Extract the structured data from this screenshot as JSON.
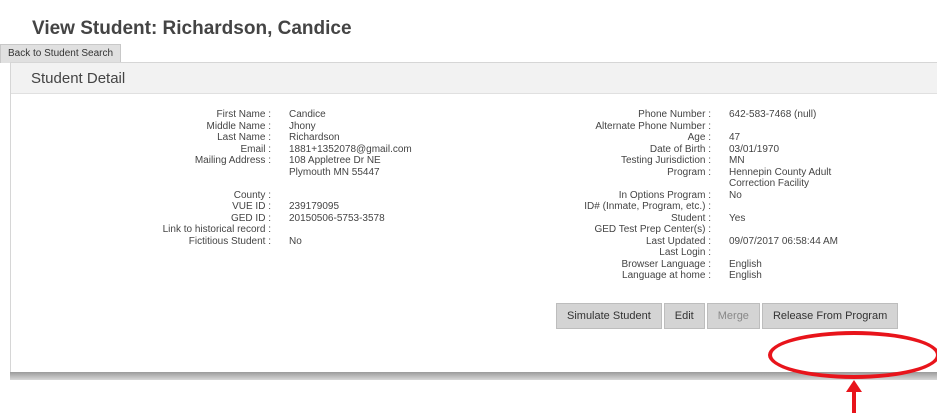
{
  "page": {
    "title": "View Student: Richardson, Candice"
  },
  "nav": {
    "back_label": "Back to Student Search"
  },
  "panel": {
    "title": "Student Detail"
  },
  "left_fields": [
    {
      "label": "First Name :",
      "value": "Candice"
    },
    {
      "label": "Middle Name :",
      "value": "Jhony"
    },
    {
      "label": "Last Name :",
      "value": "Richardson"
    },
    {
      "label": "Email :",
      "value": "1881+1352078@gmail.com"
    },
    {
      "label": "Mailing Address :",
      "value": "108 Appletree Dr NE"
    },
    {
      "label": "",
      "value": "Plymouth MN 55447"
    },
    {
      "label": "",
      "value": ""
    },
    {
      "label": "County :",
      "value": ""
    },
    {
      "label": "VUE ID :",
      "value": "239179095"
    },
    {
      "label": "GED ID :",
      "value": "20150506-5753-3578"
    },
    {
      "label": "Link to historical record :",
      "value": ""
    },
    {
      "label": "Fictitious Student :",
      "value": "No"
    }
  ],
  "right_fields": [
    {
      "label": "Phone Number :",
      "value": "642-583-7468 (null)"
    },
    {
      "label": "Alternate Phone Number :",
      "value": ""
    },
    {
      "label": "Age :",
      "value": "47"
    },
    {
      "label": "Date of Birth :",
      "value": "03/01/1970"
    },
    {
      "label": "Testing Jurisdiction :",
      "value": "MN"
    },
    {
      "label": "Program :",
      "value": "Hennepin County Adult"
    },
    {
      "label": "",
      "value": "Correction Facility"
    },
    {
      "label": "In Options Program :",
      "value": "No"
    },
    {
      "label": "ID# (Inmate, Program, etc.) :",
      "value": ""
    },
    {
      "label": "Student :",
      "value": "Yes"
    },
    {
      "label": "GED Test Prep Center(s) :",
      "value": ""
    },
    {
      "label": "Last Updated :",
      "value": "09/07/2017 06:58:44 AM"
    },
    {
      "label": "Last Login :",
      "value": ""
    },
    {
      "label": "Browser Language :",
      "value": "English"
    },
    {
      "label": "Language at home :",
      "value": "English"
    }
  ],
  "actions": {
    "simulate_label": "Simulate Student",
    "edit_label": "Edit",
    "merge_label": "Merge",
    "release_label": "Release From Program"
  },
  "colors": {
    "annotation": "#e8141b"
  }
}
